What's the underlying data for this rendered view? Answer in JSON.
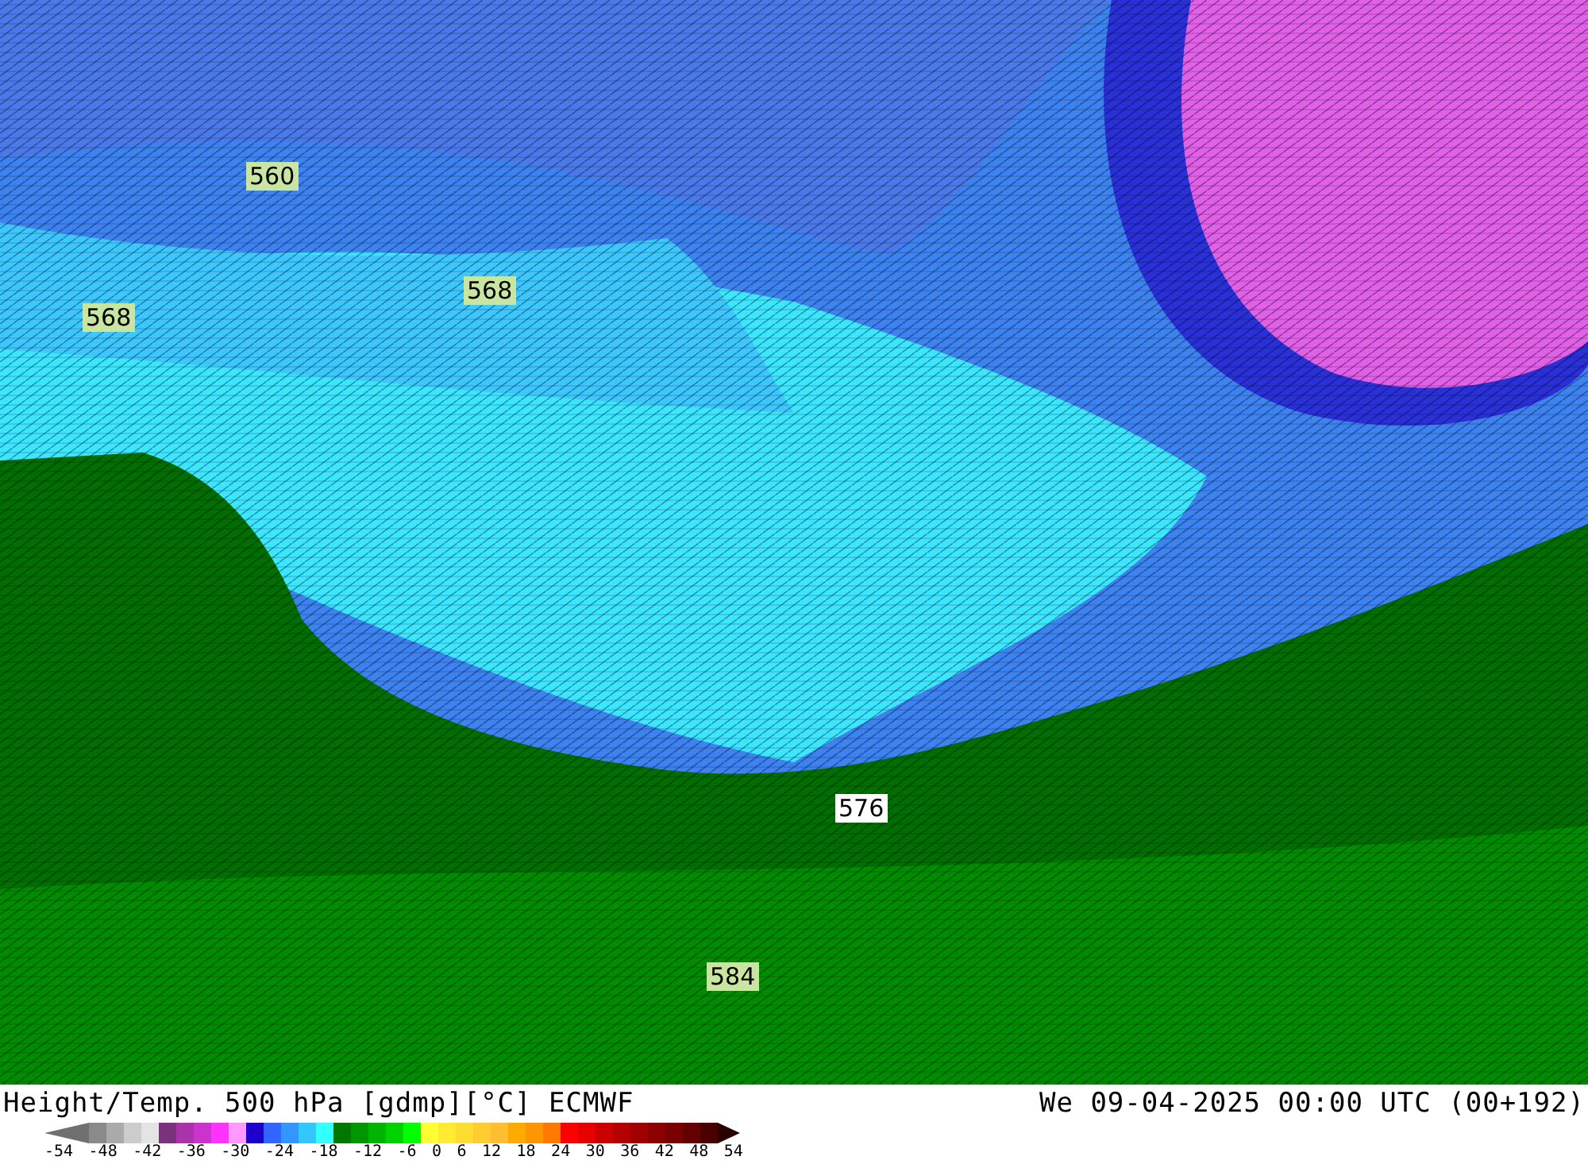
{
  "map": {
    "contour_labels": [
      {
        "text": "560",
        "color": "#c8e6a0"
      },
      {
        "text": "568",
        "color": "#c8e6a0"
      },
      {
        "text": "568",
        "color": "#c8e6a0"
      },
      {
        "text": "576",
        "color": "#ffffff"
      },
      {
        "text": "584",
        "color": "#c8e6a0"
      }
    ]
  },
  "footer": {
    "title": "Height/Temp. 500 hPa [gdmp][°C] ECMWF",
    "datetime": "We 09-04-2025 00:00 UTC (00+192)"
  },
  "legend": {
    "swatches": [
      {
        "kind": "arrow-left",
        "color": "#707070"
      },
      {
        "kind": "swatch",
        "color": "#8a8a8a"
      },
      {
        "kind": "swatch",
        "color": "#aaaaaa"
      },
      {
        "kind": "swatch",
        "color": "#cccccc"
      },
      {
        "kind": "swatch",
        "color": "#e4e4e4"
      },
      {
        "kind": "swatch",
        "color": "#7a327a"
      },
      {
        "kind": "swatch",
        "color": "#aa32aa"
      },
      {
        "kind": "swatch",
        "color": "#cc32cc"
      },
      {
        "kind": "swatch",
        "color": "#ff32ff"
      },
      {
        "kind": "swatch",
        "color": "#ff99ff"
      },
      {
        "kind": "swatch",
        "color": "#1e00cc"
      },
      {
        "kind": "swatch",
        "color": "#3264ff"
      },
      {
        "kind": "swatch",
        "color": "#3296ff"
      },
      {
        "kind": "swatch",
        "color": "#32c8ff"
      },
      {
        "kind": "swatch",
        "color": "#32ffff"
      },
      {
        "kind": "swatch",
        "color": "#007800"
      },
      {
        "kind": "swatch",
        "color": "#009600"
      },
      {
        "kind": "swatch",
        "color": "#00b400"
      },
      {
        "kind": "swatch",
        "color": "#00d200"
      },
      {
        "kind": "swatch",
        "color": "#00ff00"
      },
      {
        "kind": "swatch",
        "color": "#ffff32"
      },
      {
        "kind": "swatch",
        "color": "#ffeb32"
      },
      {
        "kind": "swatch",
        "color": "#ffdc32"
      },
      {
        "kind": "swatch",
        "color": "#ffcd32"
      },
      {
        "kind": "swatch",
        "color": "#ffbe32"
      },
      {
        "kind": "swatch",
        "color": "#ffaa00"
      },
      {
        "kind": "swatch",
        "color": "#ff9600"
      },
      {
        "kind": "swatch",
        "color": "#ff7800"
      },
      {
        "kind": "swatch",
        "color": "#ff0000"
      },
      {
        "kind": "swatch",
        "color": "#e60000"
      },
      {
        "kind": "swatch",
        "color": "#cc0000"
      },
      {
        "kind": "swatch",
        "color": "#b40000"
      },
      {
        "kind": "swatch",
        "color": "#a00000"
      },
      {
        "kind": "swatch",
        "color": "#8c0000"
      },
      {
        "kind": "swatch",
        "color": "#780000"
      },
      {
        "kind": "swatch",
        "color": "#640000"
      },
      {
        "kind": "swatch",
        "color": "#4b0000"
      },
      {
        "kind": "arrow-right",
        "color": "#2a0000"
      }
    ],
    "ticks": [
      "-54",
      "-48",
      "-42",
      "-36",
      "-30",
      "-24",
      "-18",
      "-12",
      "-6",
      "0",
      "6",
      "12",
      "18",
      "24",
      "30",
      "36",
      "42",
      "48",
      "54"
    ]
  }
}
